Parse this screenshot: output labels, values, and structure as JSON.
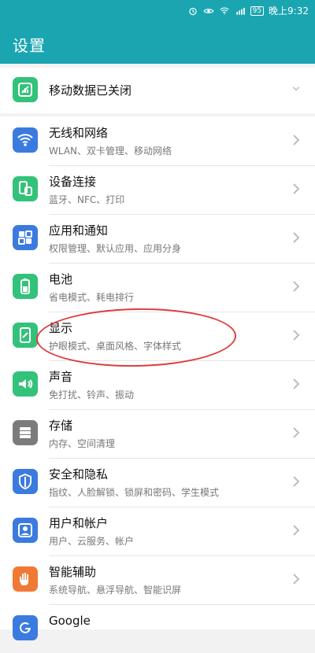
{
  "status_bar": {
    "battery": "95",
    "time": "晚上9:32"
  },
  "header": {
    "title": "设置"
  },
  "mobile_data": {
    "label": "移动数据已关闭"
  },
  "settings": [
    {
      "title": "无线和网络",
      "subtitle": "WLAN、双卡管理、移动网络",
      "icon": "wifi-icon",
      "color": "#3b7be0"
    },
    {
      "title": "设备连接",
      "subtitle": "蓝牙、NFC、打印",
      "icon": "device-connection-icon",
      "color": "#33c27a"
    },
    {
      "title": "应用和通知",
      "subtitle": "权限管理、默认应用、应用分身",
      "icon": "apps-grid-icon",
      "color": "#3b7be0"
    },
    {
      "title": "电池",
      "subtitle": "省电模式、耗电排行",
      "icon": "battery-icon",
      "color": "#33c27a"
    },
    {
      "title": "显示",
      "subtitle": "护眼模式、桌面风格、字体样式",
      "icon": "display-icon",
      "color": "#33c27a"
    },
    {
      "title": "声音",
      "subtitle": "免打扰、铃声、振动",
      "icon": "speaker-icon",
      "color": "#33c27a"
    },
    {
      "title": "存储",
      "subtitle": "内存、空间清理",
      "icon": "storage-icon",
      "color": "#7b7b7b"
    },
    {
      "title": "安全和隐私",
      "subtitle": "指纹、人脸解锁、锁屏和密码、学生模式",
      "icon": "shield-icon",
      "color": "#3b7be0"
    },
    {
      "title": "用户和帐户",
      "subtitle": "用户、云服务、帐户",
      "icon": "user-icon",
      "color": "#3b7be0"
    },
    {
      "title": "智能辅助",
      "subtitle": "系统导航、悬浮导航、智能识屏",
      "icon": "hand-icon",
      "color": "#f07a35"
    },
    {
      "title": "Google",
      "subtitle": "",
      "icon": "google-icon",
      "color": "#3b7be0"
    }
  ]
}
